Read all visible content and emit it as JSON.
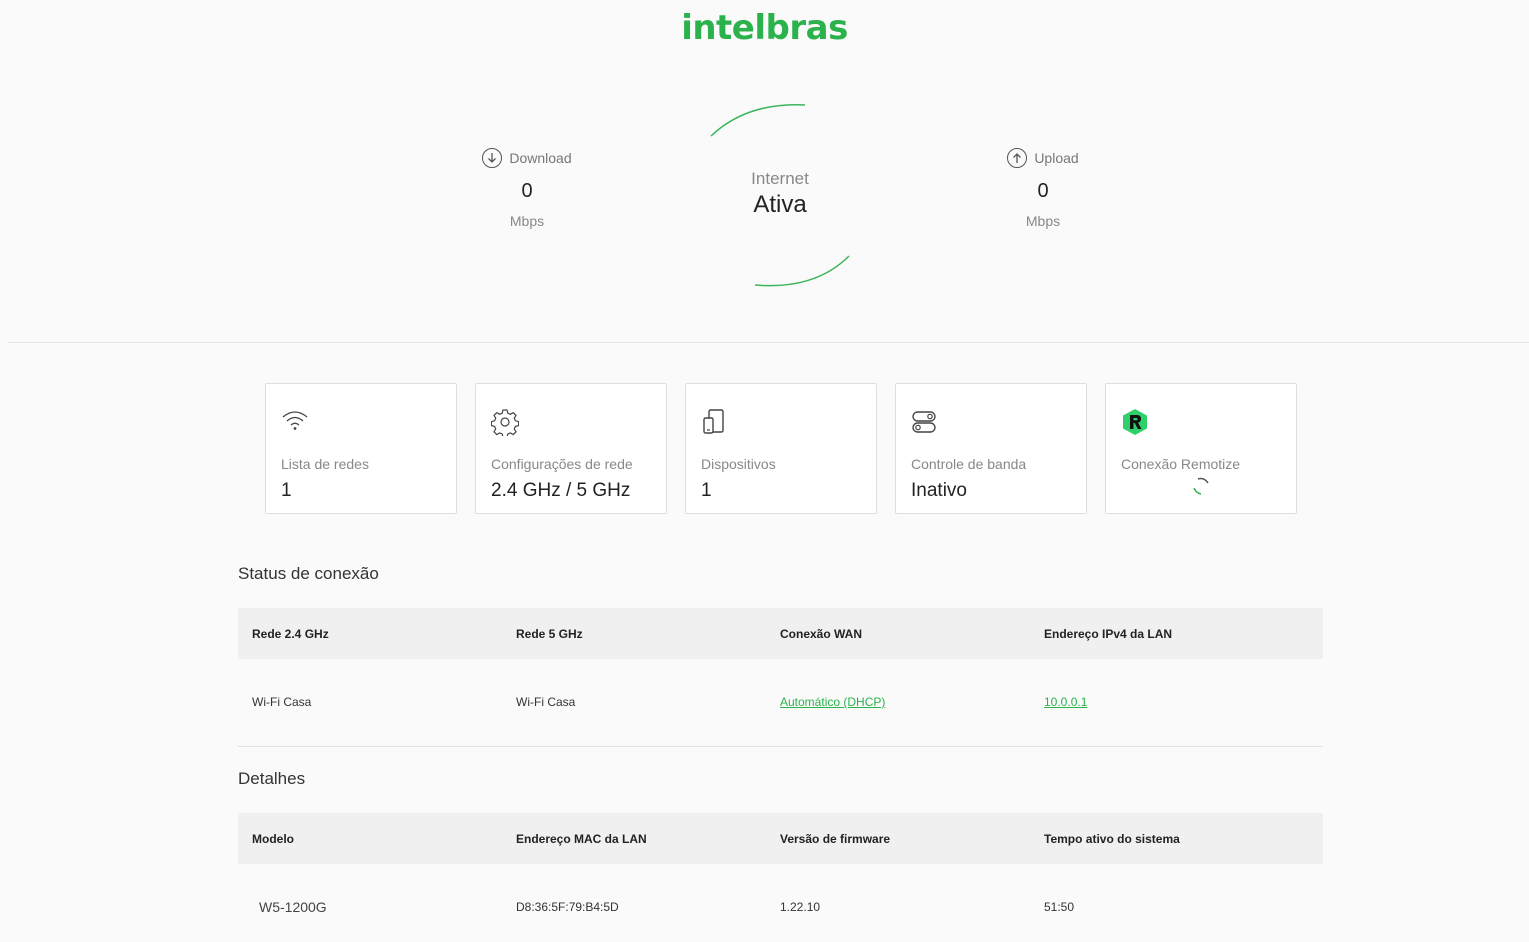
{
  "brand": {
    "logo": "intelbras",
    "accent": "#2bb24c"
  },
  "speed": {
    "download": {
      "label": "Download",
      "value": "0",
      "unit": "Mbps",
      "icon": "arrow-down-circle-icon"
    },
    "upload": {
      "label": "Upload",
      "value": "0",
      "unit": "Mbps",
      "icon": "arrow-up-circle-icon"
    }
  },
  "internet": {
    "label": "Internet",
    "status": "Ativa"
  },
  "cards": [
    {
      "icon": "wifi-icon",
      "title": "Lista de redes",
      "value": "1"
    },
    {
      "icon": "gear-icon",
      "title": "Configurações de rede",
      "value": "2.4 GHz / 5 GHz"
    },
    {
      "icon": "devices-icon",
      "title": "Dispositivos",
      "value": "1"
    },
    {
      "icon": "toggles-icon",
      "title": "Controle de banda",
      "value": "Inativo"
    },
    {
      "icon": "remotize-logo-icon",
      "title": "Conexão Remotize",
      "value": ""
    }
  ],
  "status": {
    "title": "Status de conexão",
    "headers": [
      "Rede 2.4 GHz",
      "Rede 5 GHz",
      "Conexão WAN",
      "Endereço IPv4 da LAN"
    ],
    "row": [
      "Wi-Fi Casa",
      "Wi-Fi Casa",
      "Automático (DHCP)",
      "10.0.0.1"
    ]
  },
  "details": {
    "title": "Detalhes",
    "headers": [
      "Modelo",
      "Endereço MAC da LAN",
      "Versão de firmware",
      "Tempo ativo do sistema"
    ],
    "row": [
      "W5-1200G",
      "D8:36:5F:79:B4:5D",
      "1.22.10",
      "51:50"
    ]
  }
}
